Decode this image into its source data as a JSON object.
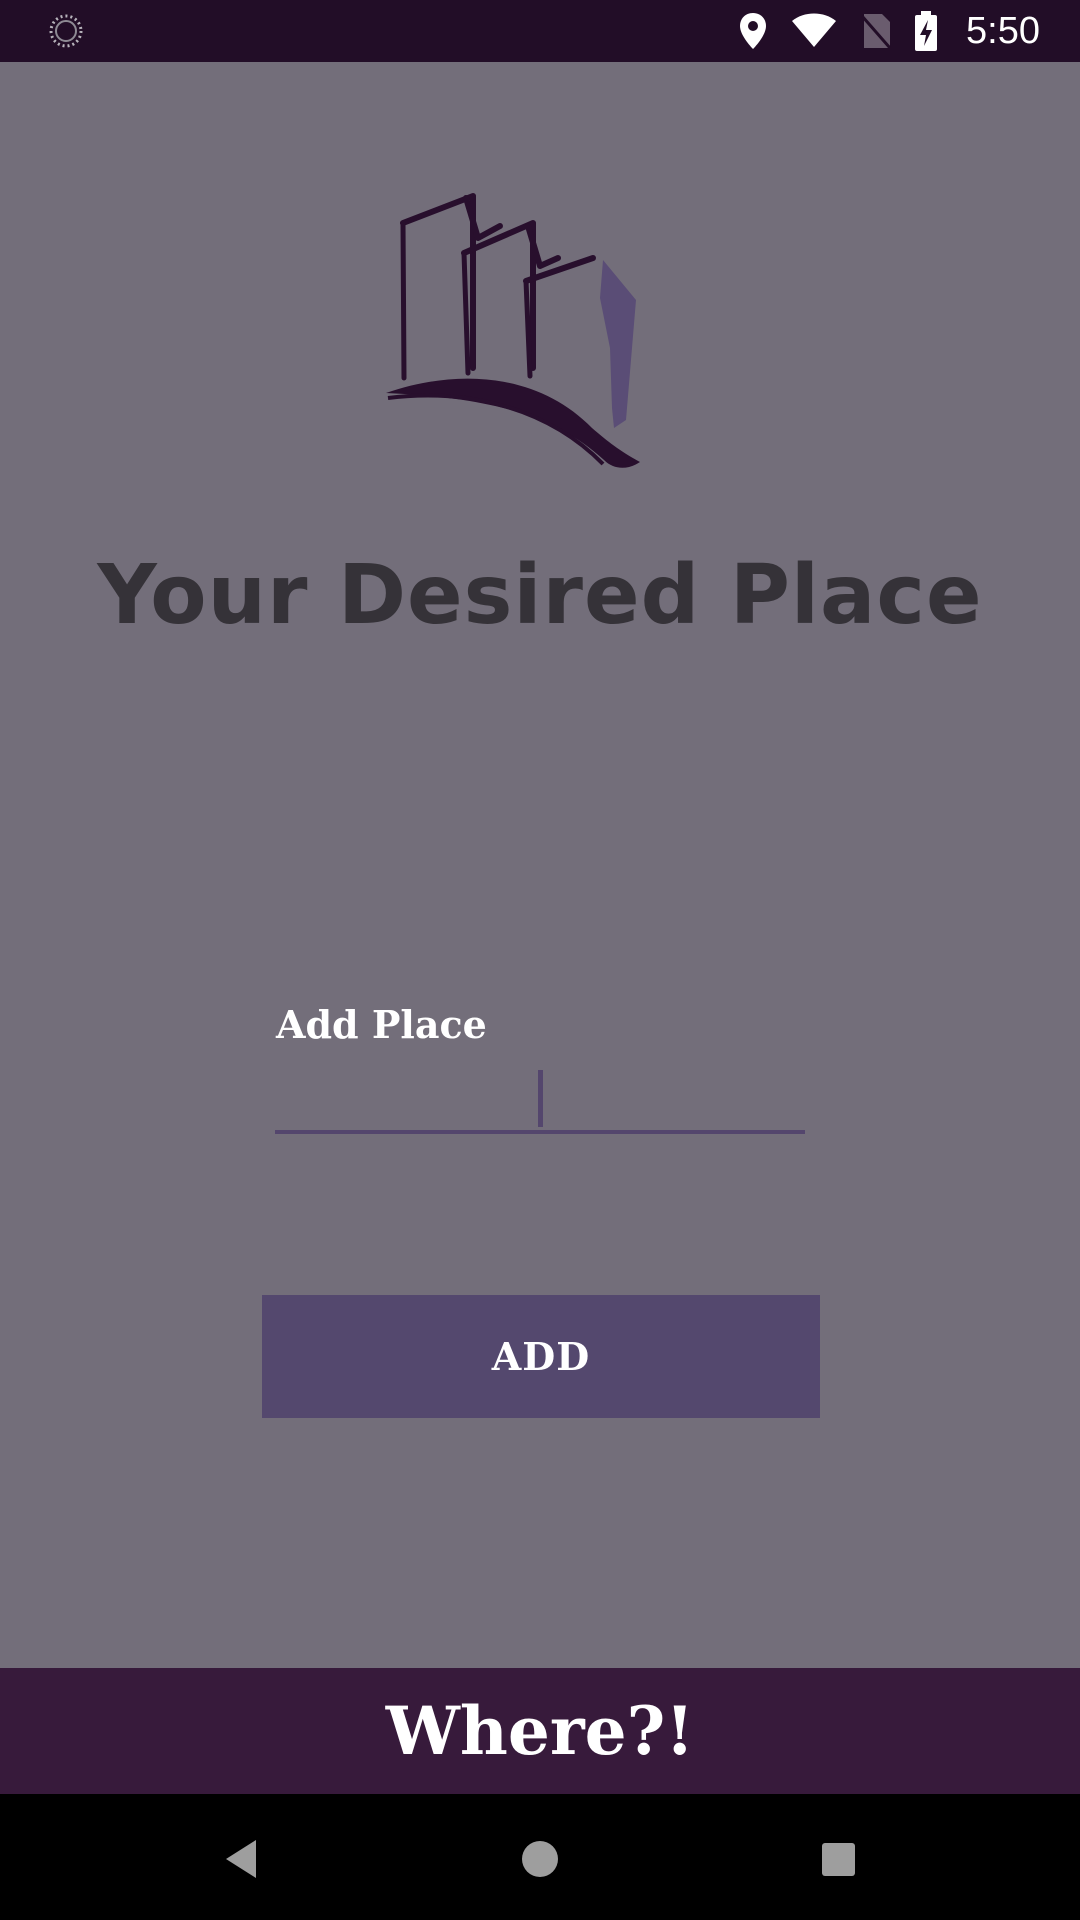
{
  "status_bar": {
    "time": "5:50",
    "icons": [
      "loading-spinner-icon",
      "location-pin-icon",
      "wifi-icon",
      "no-sim-icon",
      "battery-charging-icon"
    ]
  },
  "app": {
    "title": "Your Desired Place",
    "logo": "buildings-logo-icon",
    "colors": {
      "background": "#736e7a",
      "status_bar": "#220d27",
      "banner": "#371a3b",
      "accent": "#54486e",
      "title": "#353238"
    }
  },
  "form": {
    "label": "Add Place",
    "input_value": "",
    "add_button_label": "ADD"
  },
  "banner": {
    "text": "Where?!"
  },
  "nav_bar": {
    "icons": [
      "back-icon",
      "home-icon",
      "recents-icon"
    ]
  }
}
